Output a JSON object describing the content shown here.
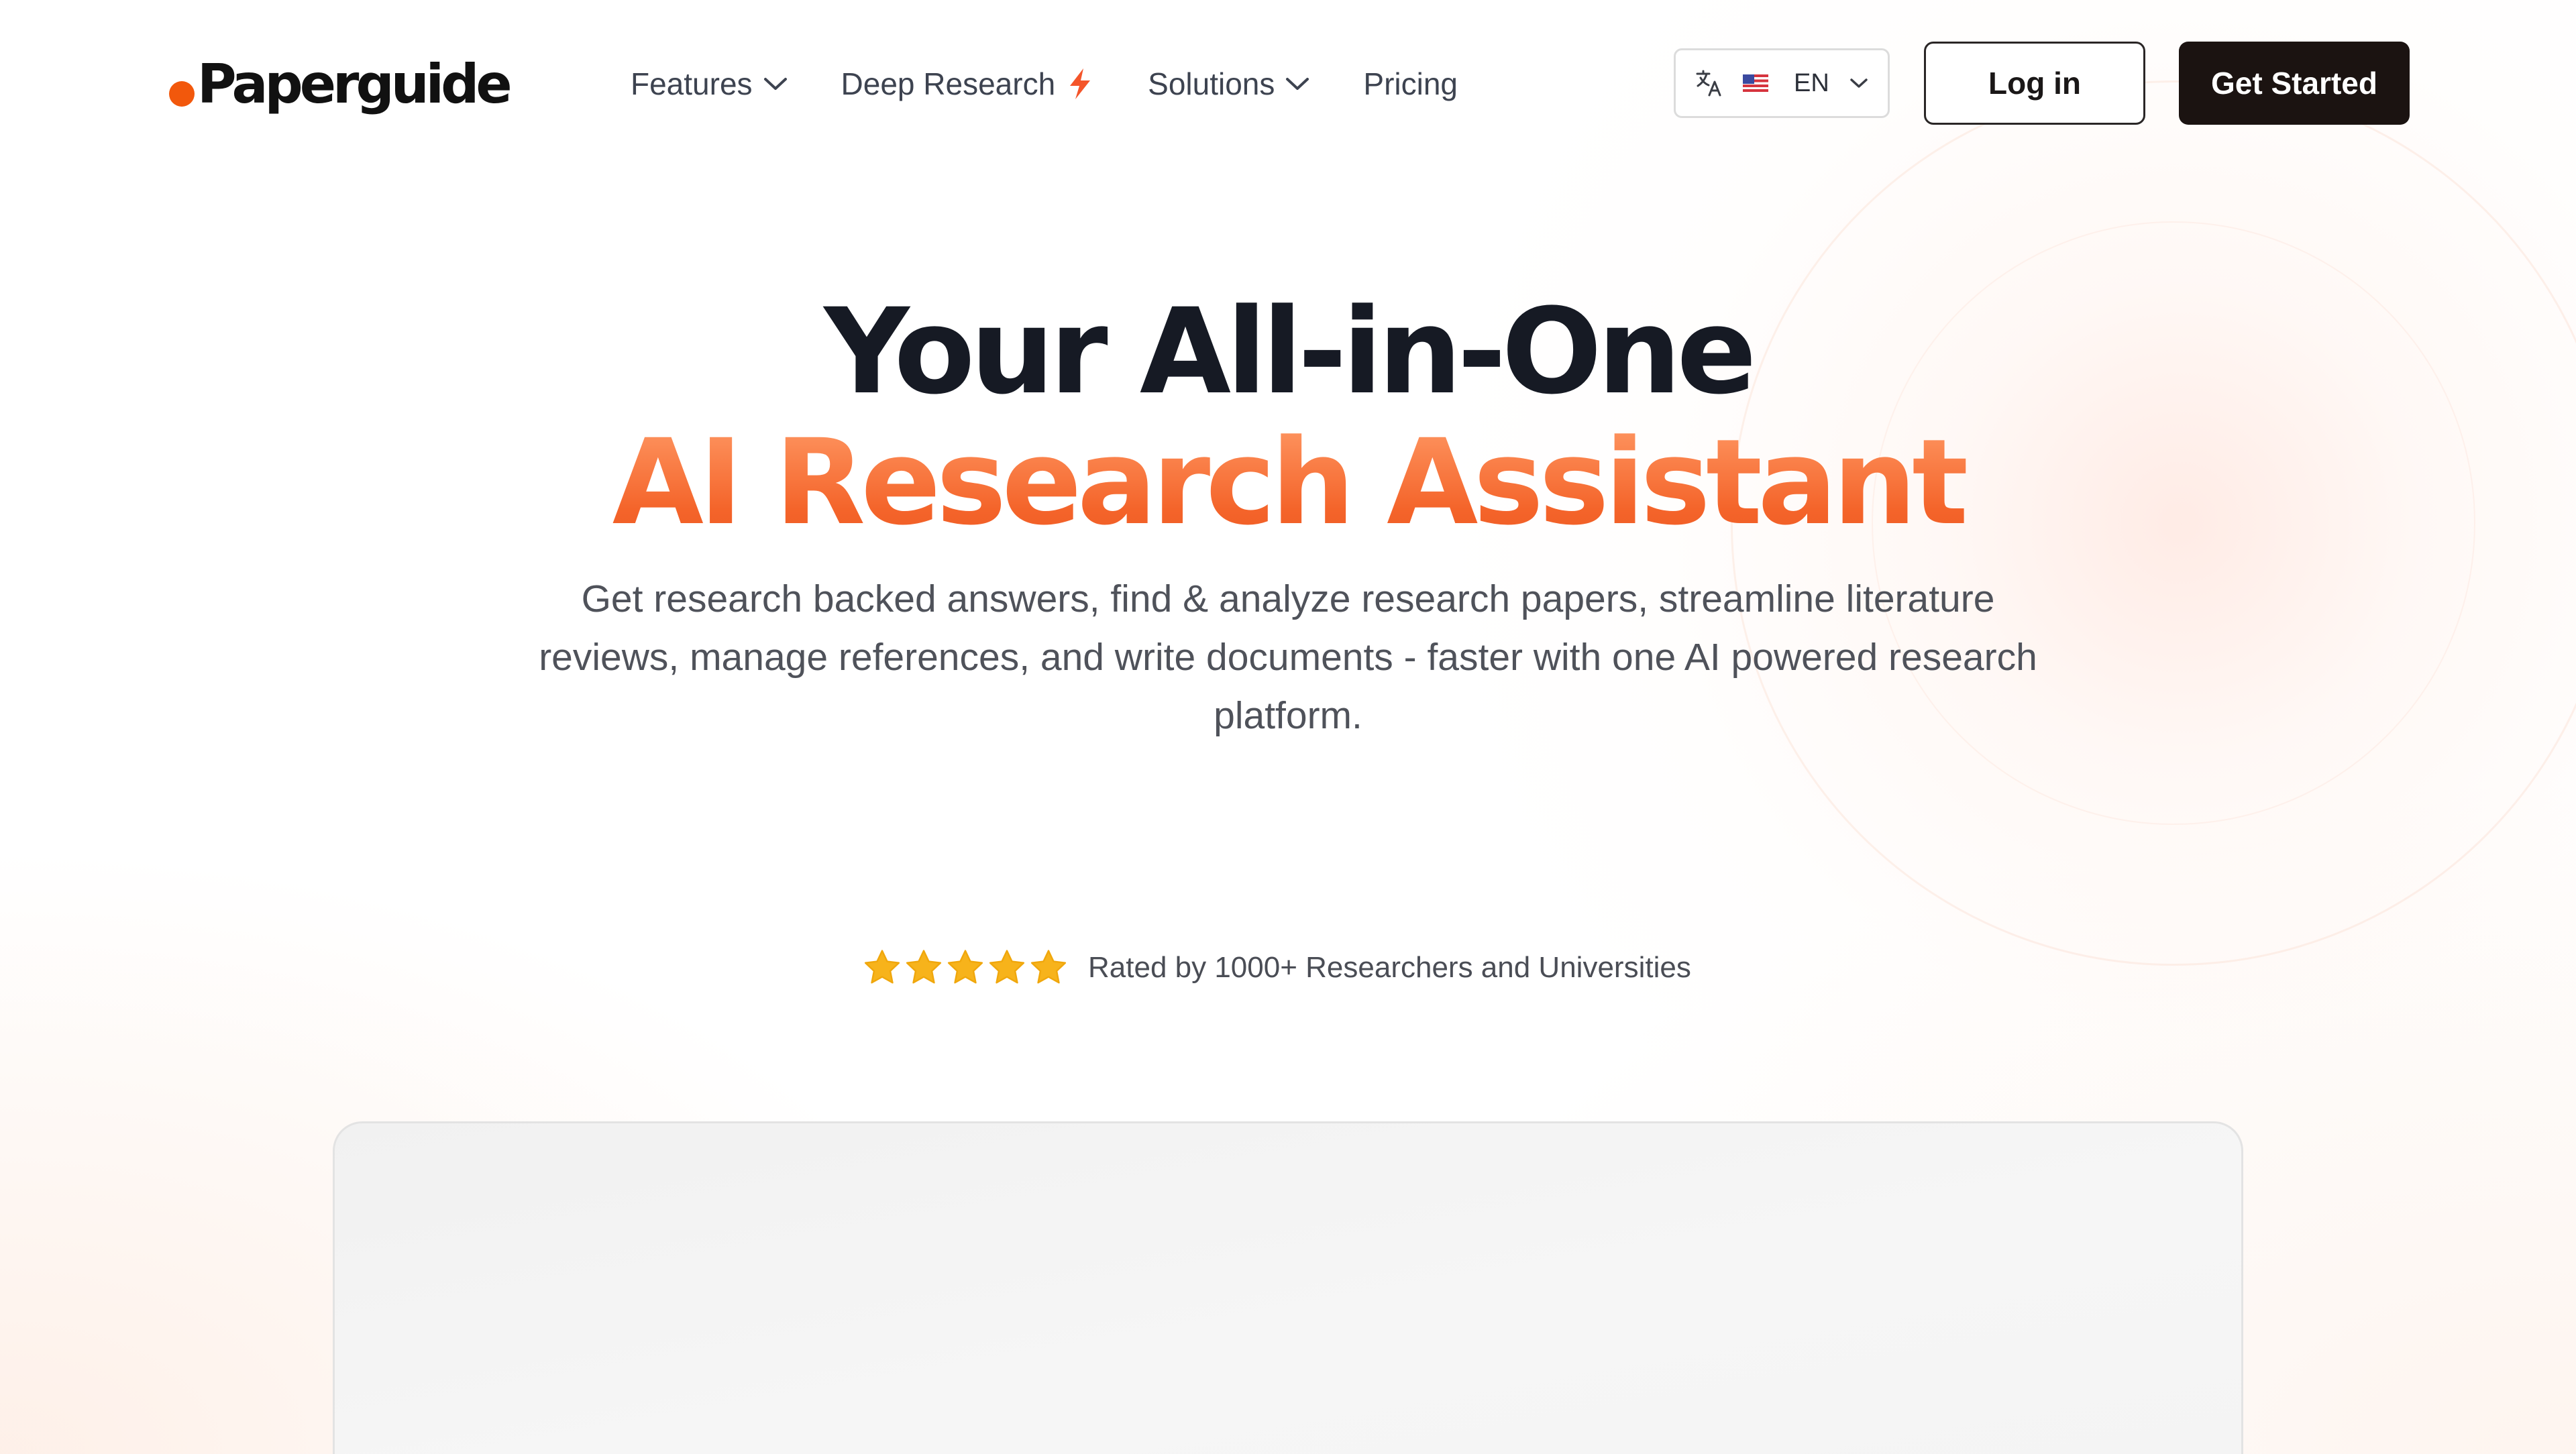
{
  "header": {
    "logo_text": "Paperguide",
    "nav": [
      {
        "label": "Features",
        "has_dropdown": true
      },
      {
        "label": "Deep Research",
        "icon": "lightning-icon"
      },
      {
        "label": "Solutions",
        "has_dropdown": true
      },
      {
        "label": "Pricing"
      }
    ],
    "language": {
      "code": "EN",
      "flag": "us-flag",
      "icon": "translate-icon"
    },
    "login_label": "Log in",
    "get_started_label": "Get Started"
  },
  "hero": {
    "title_line1": "Your All-in-One",
    "title_line2": "AI Research Assistant",
    "subtitle": "Get research backed answers, find & analyze research papers, streamline literature reviews, manage references, and write documents - faster with one AI powered research platform.",
    "rating": {
      "stars": 5,
      "max": 5,
      "text": "Rated by 1000+ Researchers and Universities"
    }
  },
  "colors": {
    "accent": "#f4642a",
    "logo_dot": "#f2580c",
    "dark_button": "#1b1311",
    "star": "#f7b31b",
    "title": "#161a24"
  }
}
